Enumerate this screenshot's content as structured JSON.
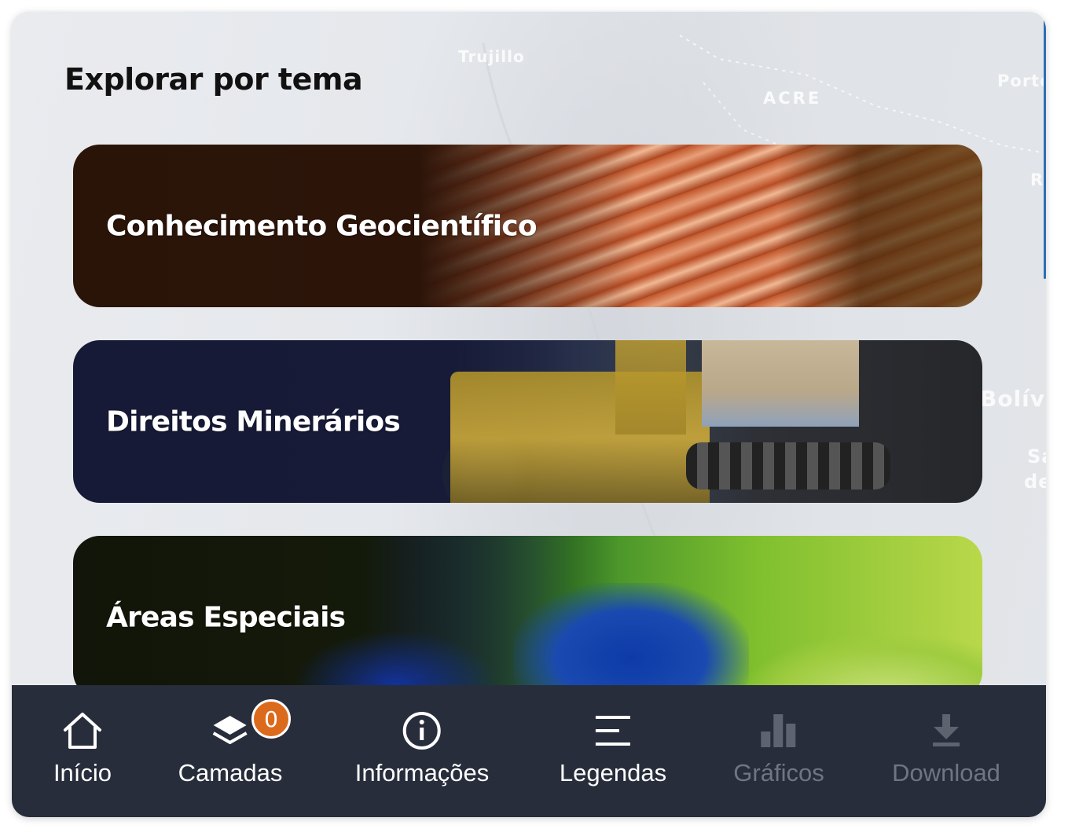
{
  "section": {
    "title": "Explorar por tema"
  },
  "map": {
    "labels": [
      "Trujillo",
      "ACRE",
      "Porto",
      "R",
      "Bolívi",
      "Sa",
      "de"
    ]
  },
  "themes": [
    {
      "label": "Conhecimento Geocientífico"
    },
    {
      "label": "Direitos Minerários"
    },
    {
      "label": "Áreas Especiais"
    }
  ],
  "nav": {
    "items": [
      {
        "label": "Início",
        "icon": "home-icon",
        "enabled": true
      },
      {
        "label": "Camadas",
        "icon": "layers-icon",
        "enabled": true,
        "badge": "0"
      },
      {
        "label": "Informações",
        "icon": "info-icon",
        "enabled": true
      },
      {
        "label": "Legendas",
        "icon": "legend-icon",
        "enabled": true
      },
      {
        "label": "Gráficos",
        "icon": "bar-chart-icon",
        "enabled": false
      },
      {
        "label": "Download",
        "icon": "download-icon",
        "enabled": false
      }
    ]
  },
  "colors": {
    "nav_bg": "#272d3b",
    "badge": "#dc6a1c",
    "disabled_text": "#6f7582",
    "scroll_indicator": "#2f6db5"
  }
}
